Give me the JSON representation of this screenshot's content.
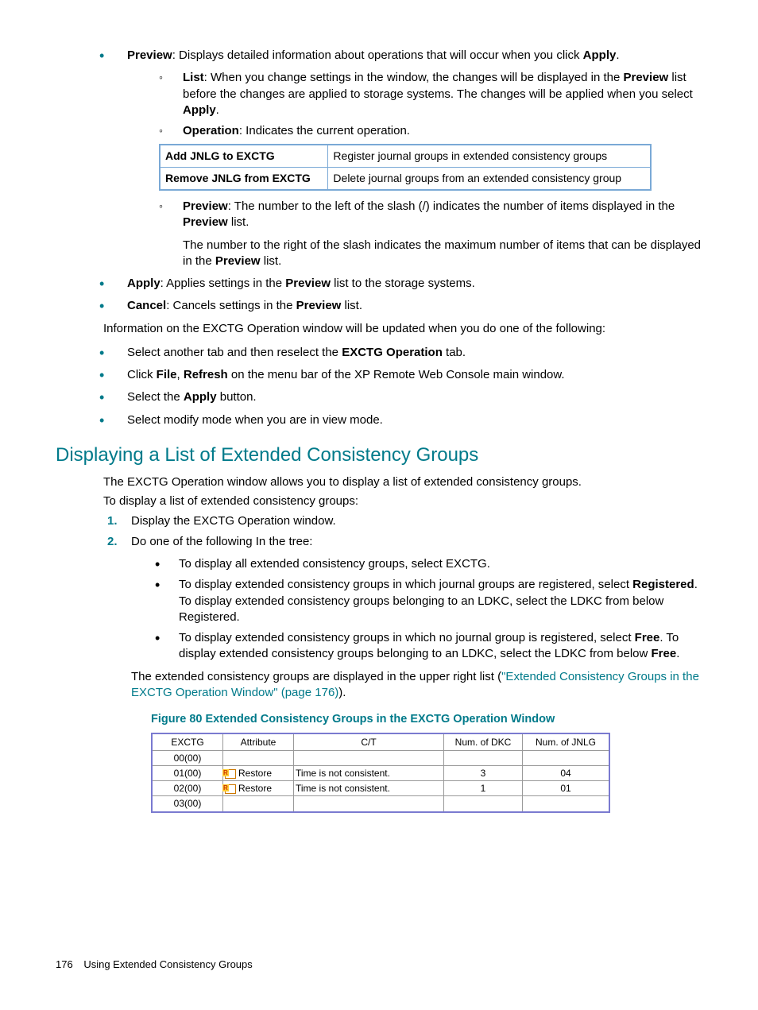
{
  "bullets": {
    "preview": {
      "bold": "Preview",
      "text": ": Displays detailed information about operations that will occur when you click ",
      "bold2": "Apply",
      "text2": "."
    },
    "list": {
      "bold": "List",
      "text1": ": When you change settings in the window, the changes will be displayed in the ",
      "bold2": "Preview",
      "text2": " list before the changes are applied to storage systems. The changes will be applied when you select ",
      "bold3": "Apply",
      "text3": "."
    },
    "operation": {
      "bold": "Operation",
      "text": ": Indicates the current operation."
    },
    "op_table": {
      "r1c1": "Add JNLG to EXCTG",
      "r1c2": "Register journal groups in extended consistency groups",
      "r2c1": "Remove JNLG from EXCTG",
      "r2c2": "Delete journal groups from an extended consistency group"
    },
    "preview2": {
      "bold": "Preview",
      "t1": ": The number to the left of the slash (/) indicates the number of items displayed in the ",
      "bold2": "Preview",
      "t2": " list.",
      "para2a": "The number to the right of the slash indicates the maximum number of items that can be displayed in the ",
      "bold3": "Preview",
      "para2b": " list."
    },
    "apply": {
      "bold": "Apply",
      "t1": ": Applies settings in the ",
      "bold2": "Preview",
      "t2": " list to the storage systems."
    },
    "cancel": {
      "bold": "Cancel",
      "t1": ": Cancels settings in the ",
      "bold2": "Preview",
      "t2": " list."
    }
  },
  "info_line": "Information on the EXCTG Operation window will be updated when you do one of the following:",
  "update_list": {
    "i1a": "Select another tab and then reselect the ",
    "i1b": "EXCTG Operation",
    "i1c": " tab.",
    "i2a": "Click ",
    "i2b": "File",
    "i2c": ", ",
    "i2d": "Refresh",
    "i2e": " on the menu bar of the XP Remote Web Console main window.",
    "i3a": "Select the ",
    "i3b": "Apply",
    "i3c": " button.",
    "i4": "Select modify mode when you are in view mode."
  },
  "section_heading": "Displaying a List of Extended Consistency Groups",
  "section_p1": "The EXCTG Operation window allows you to display a list of extended consistency groups.",
  "section_p2": "To display a list of extended consistency groups:",
  "steps": {
    "n1": "1.",
    "s1": "Display the EXCTG Operation window.",
    "n2": "2.",
    "s2": "Do one of the following In the tree:",
    "s2a": "To display all extended consistency groups, select EXCTG.",
    "s2b1": "To display extended consistency groups in which journal groups are registered, select ",
    "s2b_bold": "Registered",
    "s2b2": ". To display extended consistency groups belonging to an LDKC, select the LDKC from below Registered.",
    "s2c1": "To display extended consistency groups in which no journal group is registered, select ",
    "s2c_bold": "Free",
    "s2c2": ". To display extended consistency groups belonging to an LDKC, select the LDKC from below ",
    "s2c_bold2": "Free",
    "s2c3": ".",
    "after1": "The extended consistency groups are displayed in the upper right list (",
    "link": "\"Extended Consistency Groups in the EXCTG Operation Window\" (page 176)",
    "after2": ")."
  },
  "figure_caption": "Figure 80 Extended Consistency Groups in the EXCTG Operation Window",
  "fig_table": {
    "h1": "EXCTG",
    "h2": "Attribute",
    "h3": "C/T",
    "h4": "Num. of DKC",
    "h5": "Num. of JNLG",
    "r1": {
      "c1": "00(00)",
      "c2": "",
      "c3": "",
      "c4": "",
      "c5": ""
    },
    "r2": {
      "c1": "01(00)",
      "c2": "Restore",
      "c3": "Time is not consistent.",
      "c4": "3",
      "c5": "04"
    },
    "r3": {
      "c1": "02(00)",
      "c2": "Restore",
      "c3": "Time is not consistent.",
      "c4": "1",
      "c5": "01"
    },
    "r4": {
      "c1": "03(00)",
      "c2": "",
      "c3": "",
      "c4": "",
      "c5": ""
    }
  },
  "footer": {
    "page": "176",
    "title": "Using Extended Consistency Groups"
  }
}
